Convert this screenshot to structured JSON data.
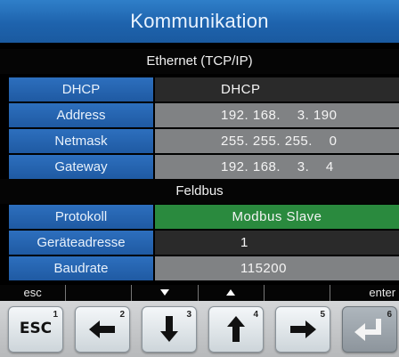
{
  "window": {
    "title": "Kommunikation"
  },
  "ethernet": {
    "header": "Ethernet (TCP/IP)",
    "rows": [
      {
        "label": "DHCP",
        "value": "DHCP"
      },
      {
        "label": "Address",
        "value": "192. 168.    3. 190"
      },
      {
        "label": "Netmask",
        "value": "255. 255. 255.    0"
      },
      {
        "label": "Gateway",
        "value": "192. 168.    3.    4"
      }
    ]
  },
  "feldbus": {
    "header": "Feldbus",
    "rows": [
      {
        "label": "Protokoll",
        "value": "Modbus Slave"
      },
      {
        "label": "Geräteadresse",
        "value": "1"
      },
      {
        "label": "Baudrate",
        "value": "115200"
      }
    ]
  },
  "softkeys": [
    "esc",
    "",
    "",
    "",
    "",
    "enter"
  ],
  "keys": [
    {
      "number": "1",
      "label": "ESC",
      "icon": "esc-key"
    },
    {
      "number": "2",
      "icon": "arrow-left-icon"
    },
    {
      "number": "3",
      "icon": "arrow-down-icon"
    },
    {
      "number": "4",
      "icon": "arrow-up-icon"
    },
    {
      "number": "5",
      "icon": "arrow-right-icon"
    },
    {
      "number": "6",
      "icon": "enter-icon"
    }
  ],
  "colors": {
    "title_bar": "#1e63ad",
    "label_cell": "#2563ae",
    "value_cell": "#808284",
    "selected_value": "#2a8a3e"
  }
}
